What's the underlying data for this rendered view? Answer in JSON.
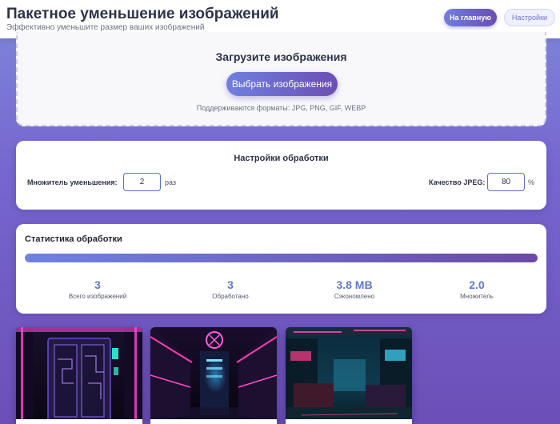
{
  "header": {
    "title": "Пакетное уменьшение изображений",
    "subtitle": "Эффективно уменьшите размер ваших изображений",
    "home_button": "На главную",
    "settings_button": "Настройки"
  },
  "upload": {
    "title": "Загрузите изображения",
    "choose_button": "Выбрать изображения",
    "formats": "Поддерживаются форматы: JPG, PNG, GIF, WEBP"
  },
  "settings": {
    "title": "Настройки обработки",
    "multiplier_label": "Множитель уменьшения:",
    "multiplier_value": "2",
    "multiplier_unit": "раз",
    "jpeg_label": "Качество JPEG:",
    "jpeg_value": "80",
    "jpeg_unit": "%"
  },
  "stats": {
    "title": "Статистика обработки",
    "progress_fraction": 1.0,
    "items": [
      {
        "value": "3",
        "label": "Всего изображений"
      },
      {
        "value": "3",
        "label": "Обработано"
      },
      {
        "value": "3.8 MB",
        "label": "Сэкономлено"
      },
      {
        "value": "2.0",
        "label": "Множитель"
      }
    ]
  },
  "images": [
    {
      "icon": "cyberpunk-door-image"
    },
    {
      "icon": "neon-corridor-image"
    },
    {
      "icon": "neon-street-image"
    }
  ],
  "colors": {
    "accent_start": "#6f82e0",
    "accent_end": "#6b4aa6",
    "stat_value": "#6277d3"
  }
}
